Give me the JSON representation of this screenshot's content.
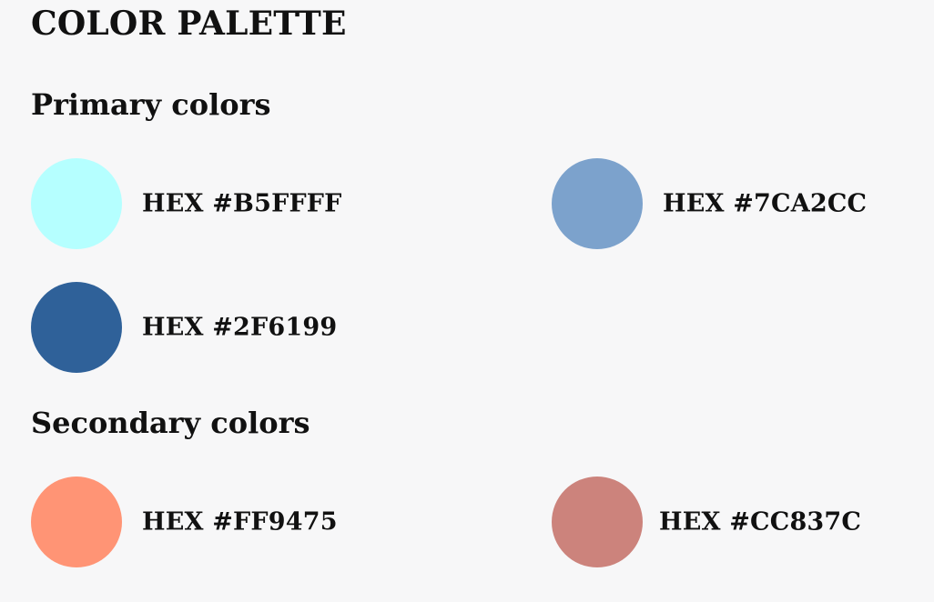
{
  "title": "COLOR PALETTE",
  "primary": {
    "heading": "Primary colors",
    "swatches": [
      {
        "label": "HEX #B5FFFF",
        "color": "#B5FFFF"
      },
      {
        "label": "HEX #7CA2CC",
        "color": "#7CA2CC"
      },
      {
        "label": "HEX #2F6199",
        "color": "#2F6199"
      }
    ]
  },
  "secondary": {
    "heading": "Secondary colors",
    "swatches": [
      {
        "label": "HEX #FF9475",
        "color": "#FF9475"
      },
      {
        "label": "HEX #CC837C",
        "color": "#CC837C"
      }
    ]
  }
}
